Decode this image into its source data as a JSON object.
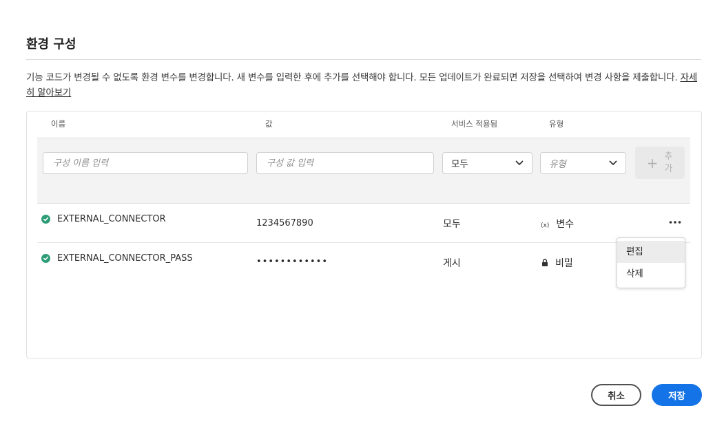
{
  "dialog": {
    "title": "환경 구성",
    "description": "기능 코드가 변경될 수 없도록 환경 변수를 변경합니다. 새 변수를 입력한 후에 추가를 선택해야 합니다. 모든 업데이트가 완료되면 저장을 선택하여 변경 사항을 제출합니다.",
    "learn_more": "자세히 알아보기"
  },
  "table": {
    "headers": {
      "name": "이름",
      "value": "값",
      "service": "서비스 적용됨",
      "type": "유형"
    },
    "new_row": {
      "name_placeholder": "구성 이름 입력",
      "value_placeholder": "구성 값 입력",
      "service_selected": "모두",
      "type_placeholder": "유형",
      "add_label": "추가"
    },
    "rows": [
      {
        "status_icon": "check-circle-icon",
        "name": "EXTERNAL_CONNECTOR",
        "value": "1234567890",
        "service": "모두",
        "type_icon": "variable-icon",
        "type_symbol": "(x)",
        "type": "변수"
      },
      {
        "status_icon": "check-circle-icon",
        "name": "EXTERNAL_CONNECTOR_PASS",
        "value": "••••••••••••",
        "service": "게시",
        "type_icon": "lock-icon",
        "type": "비밀"
      }
    ]
  },
  "context_menu": {
    "items": [
      "편집",
      "삭제"
    ]
  },
  "footer": {
    "cancel_label": "취소",
    "save_label": "저장"
  },
  "colors": {
    "accent": "#1473e6",
    "success": "#2d9d78"
  }
}
